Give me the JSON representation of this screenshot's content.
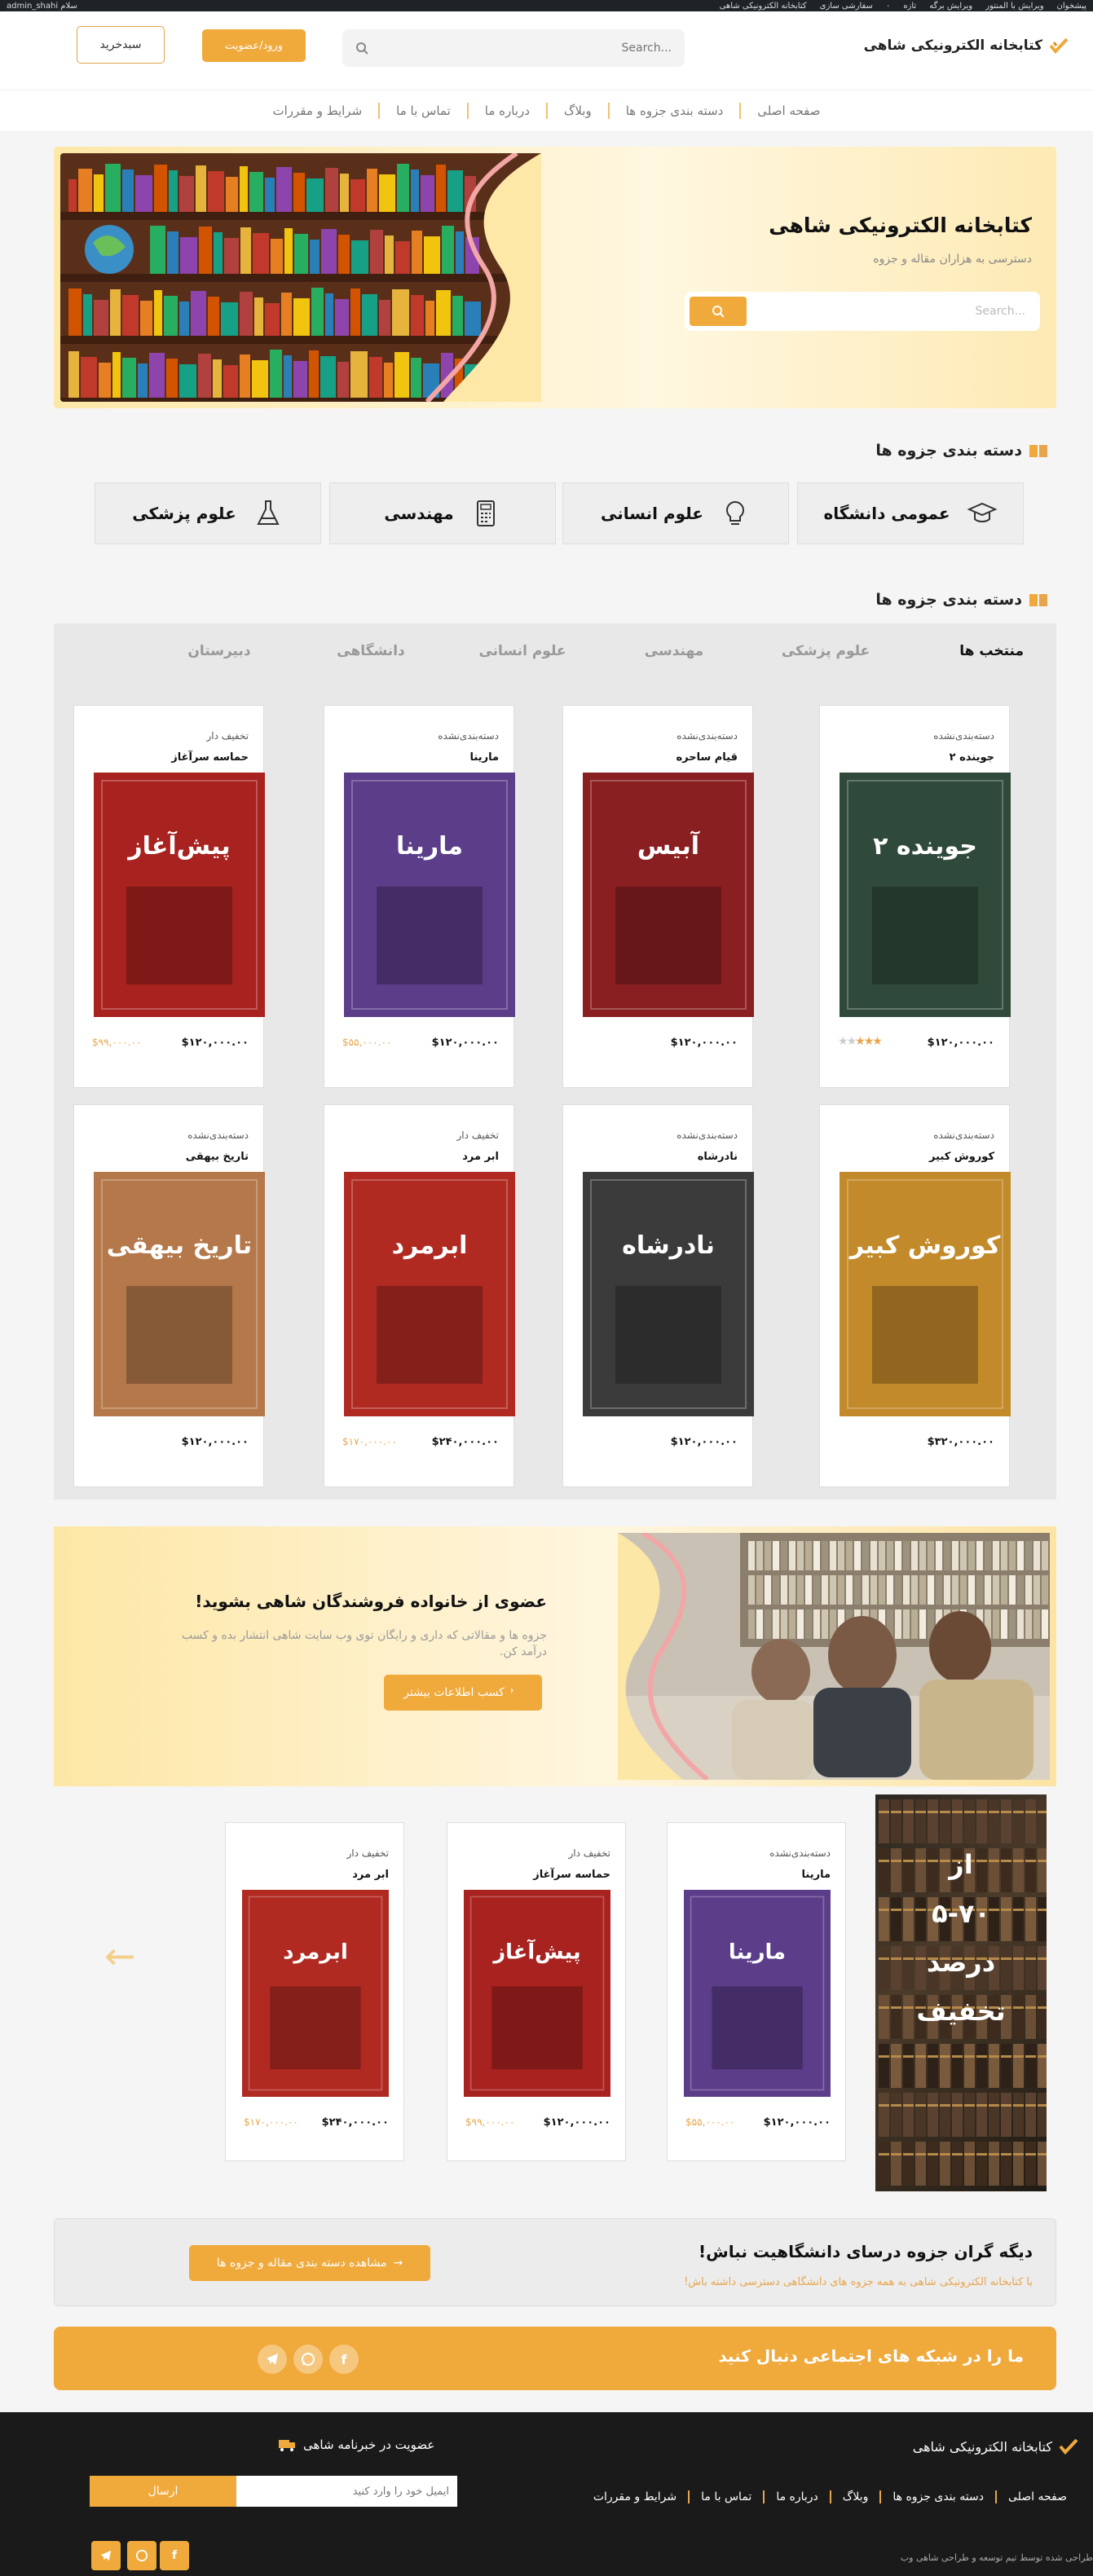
{
  "admin_bar": {
    "items": [
      "سلام admin_shahi",
      "کتابخانه الکترونیکی شاهی",
      "سفارشی سازی",
      "۰",
      "تازه",
      "ویرایش برگه",
      "ویرایش با المنتور",
      "پیشخوان"
    ]
  },
  "header": {
    "logo_text": "کتابخانه الکترونیکی شاهی",
    "search_placeholder": "...Search",
    "login_label": "ورود/عضویت",
    "cart_label": "سبدخرید"
  },
  "nav": {
    "items": [
      "صفحه اصلی",
      "دسته بندی جزوه ها",
      "وبلاگ",
      "درباره ما",
      "تماس با ما",
      "شرایط و مقررات"
    ]
  },
  "hero": {
    "title": "کتابخانه الکترونیکی شاهی",
    "subtitle": "دسترسی به هزاران مقاله و جزوه",
    "search_placeholder": "...Search"
  },
  "categories": {
    "title": "دسته بندی جزوه ها",
    "items": [
      {
        "label": "عمومی دانشگاه",
        "icon": "graduation-cap-icon"
      },
      {
        "label": "علوم انسانی",
        "icon": "lightbulb-icon"
      },
      {
        "label": "مهندسی",
        "icon": "calculator-icon"
      },
      {
        "label": "علوم پزشکی",
        "icon": "flask-icon"
      }
    ]
  },
  "products": {
    "title": "دسته بندی جزوه ها",
    "tabs": [
      "منتخب ها",
      "علوم پزشکی",
      "مهندسی",
      "علوم انسانی",
      "دانشگاهی",
      "دبیرستان"
    ],
    "cards": [
      {
        "badge": "دسته‌بندی‌نشده",
        "name": "جوینده ۲",
        "price": "$۱۲۰,۰۰۰.۰۰",
        "old_price": "",
        "rating": 3,
        "cover_color": "#2f4a3a",
        "cover_title": "جوینده ۲"
      },
      {
        "badge": "دسته‌بندی‌نشده",
        "name": "قیام ساحره",
        "price": "$۱۲۰,۰۰۰.۰۰",
        "old_price": "",
        "rating": 0,
        "cover_color": "#8a1f22",
        "cover_title": "آبیس"
      },
      {
        "badge": "دسته‌بندی‌نشده",
        "name": "مارینا",
        "price": "$۱۲۰,۰۰۰.۰۰",
        "old_price": "$۵۵,۰۰۰.۰۰",
        "rating": 0,
        "cover_color": "#5b3d8a",
        "cover_title": "مارینا"
      },
      {
        "badge": "تخفیف دار",
        "name": "حماسه سرآغاز",
        "price": "$۱۲۰,۰۰۰.۰۰",
        "old_price": "$۹۹,۰۰۰.۰۰",
        "rating": 0,
        "cover_color": "#a8221f",
        "cover_title": "پیش‌آغاز"
      },
      {
        "badge": "دسته‌بندی‌نشده",
        "name": "کوروش کبیر",
        "price": "$۳۲۰,۰۰۰.۰۰",
        "old_price": "",
        "rating": 0,
        "cover_color": "#c28a2a",
        "cover_title": "کوروش کبیر"
      },
      {
        "badge": "دسته‌بندی‌نشده",
        "name": "نادرشاه",
        "price": "$۱۲۰,۰۰۰.۰۰",
        "old_price": "",
        "rating": 0,
        "cover_color": "#3b3b3b",
        "cover_title": "نادرشاه"
      },
      {
        "badge": "تخفیف دار",
        "name": "ابر مرد",
        "price": "$۲۴۰,۰۰۰.۰۰",
        "old_price": "$۱۷۰,۰۰۰.۰۰",
        "rating": 0,
        "cover_color": "#b02a22",
        "cover_title": "ابرمرد"
      },
      {
        "badge": "دسته‌بندی‌نشده",
        "name": "تاریخ بیهقی",
        "price": "$۱۲۰,۰۰۰.۰۰",
        "old_price": "",
        "rating": 0,
        "cover_color": "#b4784a",
        "cover_title": "تاریخ بیهقی"
      }
    ]
  },
  "join": {
    "title": "عضوی از خانواده فروشندگان شاهی بشوید!",
    "text": "جزوه ها و مقالاتی که داری و رایگان توی وب سایت شاهی انتشار بده و کسب درآمد کن.",
    "button": "کسب اطلاعات بیشتر"
  },
  "discount": {
    "side_text": [
      "از",
      "۵-۷۰",
      "درصد",
      "تخفیف"
    ],
    "cards": [
      {
        "badge": "دسته‌بندی‌نشده",
        "name": "مارینا",
        "price": "$۱۲۰,۰۰۰.۰۰",
        "old_price": "$۵۵,۰۰۰.۰۰",
        "cover_color": "#5b3d8a",
        "cover_title": "مارینا"
      },
      {
        "badge": "تخفیف دار",
        "name": "حماسه سرآغاز",
        "price": "$۱۲۰,۰۰۰.۰۰",
        "old_price": "$۹۹,۰۰۰.۰۰",
        "cover_color": "#a8221f",
        "cover_title": "پیش‌آغاز"
      },
      {
        "badge": "تخفیف دار",
        "name": "ابر مرد",
        "price": "$۲۴۰,۰۰۰.۰۰",
        "old_price": "$۱۷۰,۰۰۰.۰۰",
        "cover_color": "#b02a22",
        "cover_title": "ابرمرد"
      }
    ]
  },
  "cta": {
    "title": "دیگه گران جزوه درسای دانشگاهیت نباش!",
    "text": "با کتابخانه الکترونیکی شاهی به همه جزوه های دانشگاهی دسترسی داشته باش!",
    "button": "مشاهده دسته بندی مقاله و جزوه ها"
  },
  "social": {
    "title": "ما را در شبکه های اجتماعی دنبال کنید"
  },
  "footer": {
    "logo_text": "کتابخانه الکترونیکی شاهی",
    "newsletter_title": "عضویت در خبرنامه شاهی",
    "email_placeholder": "ایمیل خود را وارد کنید",
    "send_label": "ارسال",
    "nav": [
      "صفحه اصلی",
      "دسته بندی جزوه ها",
      "وبلاگ",
      "درباره ما",
      "تماس با ما",
      "شرایط و مقررات"
    ],
    "copyright": "طراحی شده توسط تیم توسعه و طراحی شاهی وب"
  },
  "colors": {
    "accent": "#f0a93b",
    "footer_bg": "#1a1a1a",
    "discount_text": "#e8a54b"
  }
}
